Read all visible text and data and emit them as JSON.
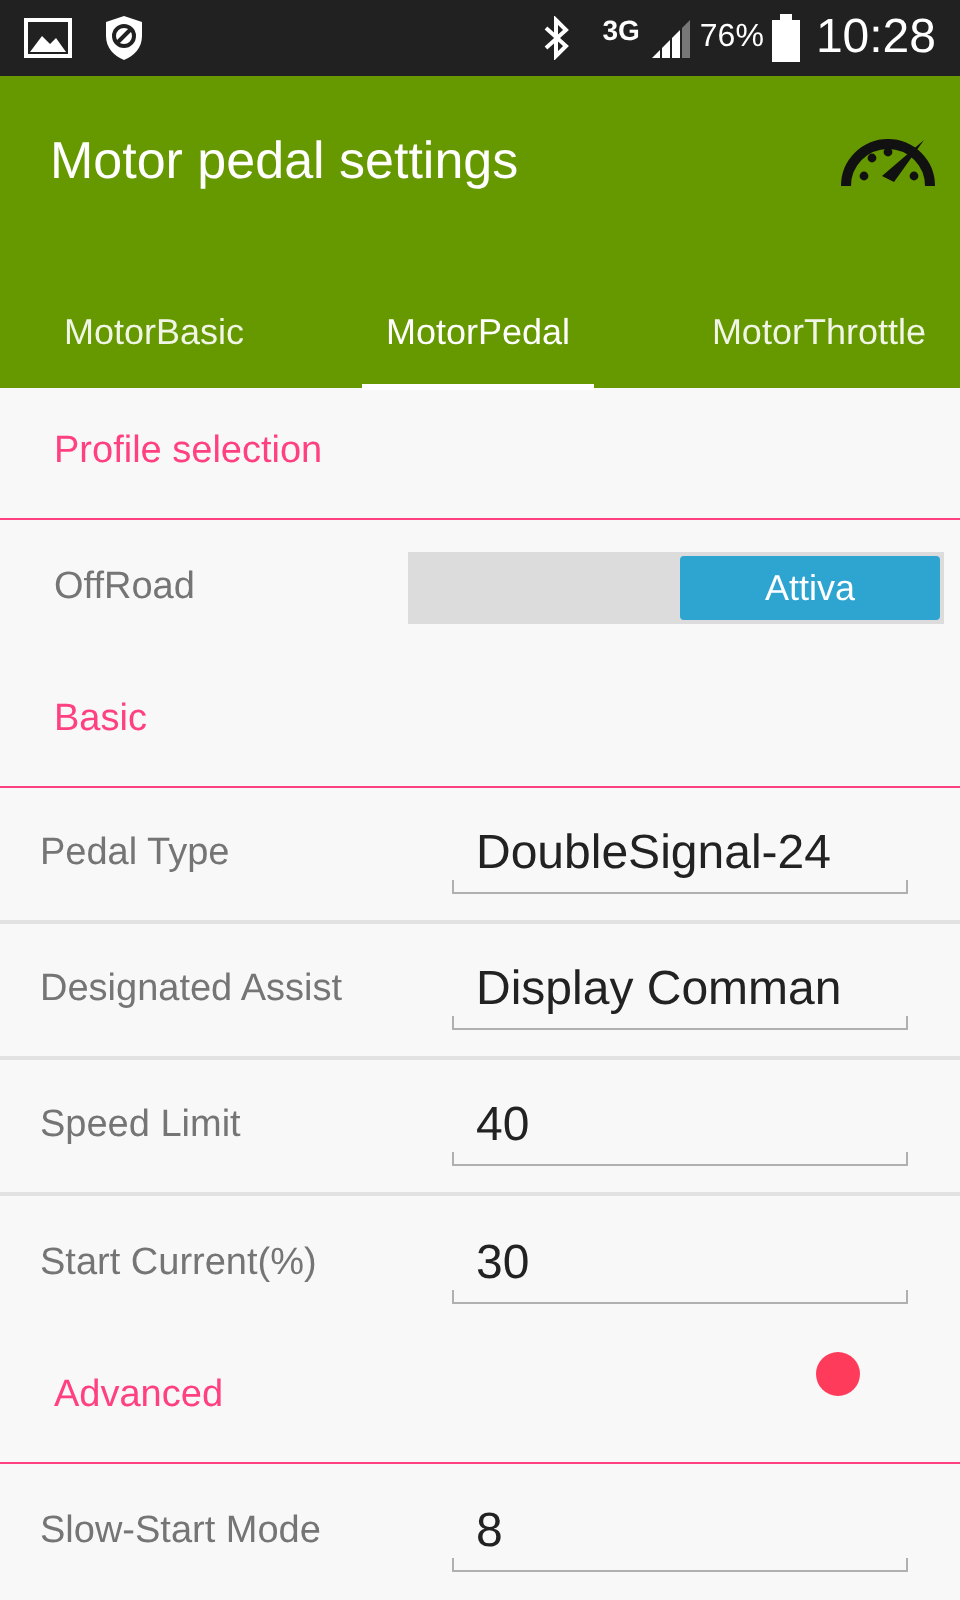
{
  "status_bar": {
    "network": "3G",
    "battery": "76%",
    "time": "10:28"
  },
  "app_bar": {
    "title": "Motor pedal settings"
  },
  "tabs": [
    {
      "label": "MotorBasic",
      "selected": false
    },
    {
      "label": "MotorPedal",
      "selected": true
    },
    {
      "label": "MotorThrottle",
      "selected": false
    }
  ],
  "sections": [
    {
      "title": "Profile selection",
      "items": [
        {
          "kind": "toggle",
          "label": "OffRoad",
          "on": true,
          "state_text": "Attiva"
        }
      ]
    },
    {
      "title": "Basic",
      "items": [
        {
          "kind": "spinner",
          "label": "Pedal Type",
          "value": "DoubleSignal-24"
        },
        {
          "kind": "spinner",
          "label": "Designated Assist",
          "value": "Display Comman"
        },
        {
          "kind": "edit",
          "label": "Speed Limit",
          "value": "40"
        },
        {
          "kind": "edit",
          "label": "Start Current(%)",
          "value": "30"
        }
      ]
    },
    {
      "title": "Advanced",
      "touch_indicator": true,
      "items": [
        {
          "kind": "edit",
          "label": "Slow-Start Mode",
          "value": "8"
        }
      ]
    }
  ]
}
